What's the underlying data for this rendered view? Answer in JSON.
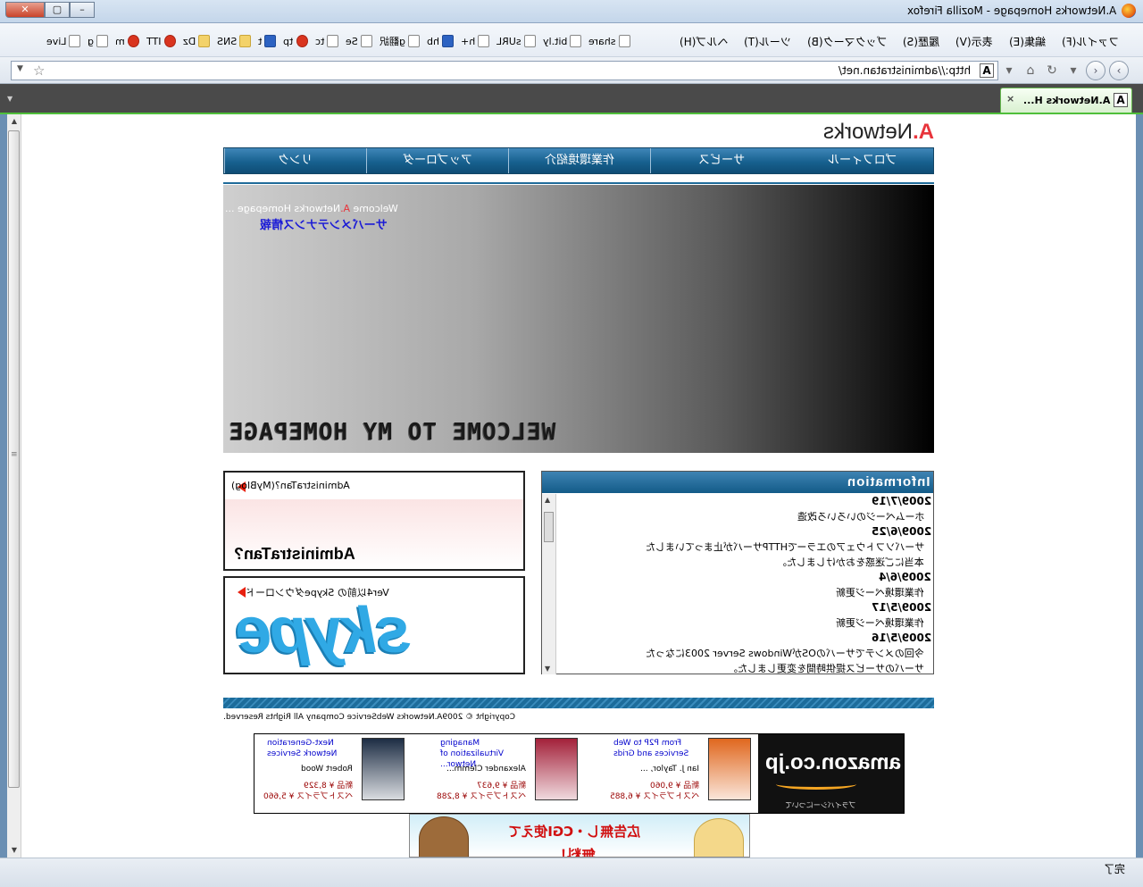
{
  "window": {
    "title": "A.Networks Homepage - Mozilla Firefox",
    "buttons": {
      "close": "✕",
      "maximize": "▢",
      "minimize": "–"
    }
  },
  "menubar": {
    "items": [
      "ファイル(F)",
      "編集(E)",
      "表示(V)",
      "履歴(S)",
      "ブックマーク(B)",
      "ツール(T)",
      "ヘルプ(H)"
    ]
  },
  "bookmarks": [
    {
      "label": "Live",
      "icon": "windows-live-icon"
    },
    {
      "label": "g",
      "icon": "google-icon"
    },
    {
      "label": "m",
      "icon": "gmail-icon"
    },
    {
      "label": "ITT",
      "icon": "itt-icon"
    },
    {
      "label": "Dz",
      "icon": "folder-icon"
    },
    {
      "label": "SNS",
      "icon": "folder-icon"
    },
    {
      "label": "t",
      "icon": "twitter-icon"
    },
    {
      "label": "tp",
      "icon": "tp-icon"
    },
    {
      "label": "tc",
      "icon": "tc-icon"
    },
    {
      "label": "Se",
      "icon": "se-icon"
    },
    {
      "label": "g翻訳",
      "icon": "page-icon"
    },
    {
      "label": "hb",
      "icon": "hatena-icon"
    },
    {
      "label": "h+",
      "icon": "page-icon"
    },
    {
      "label": "sURL",
      "icon": "page-icon"
    },
    {
      "label": "bit.ly",
      "icon": "page-icon"
    },
    {
      "label": "share",
      "icon": "page-icon"
    }
  ],
  "navbar": {
    "url": "http://administratan.net/",
    "site_icon": "A"
  },
  "tabs": [
    {
      "title": "A.Networks H...",
      "icon": "A",
      "close": "×"
    }
  ],
  "page": {
    "logo_prefix": "A.",
    "logo_text": "Networks",
    "nav": [
      "プロフィール",
      "サービス",
      "作業環境紹介",
      "アップローダ",
      "リンク"
    ],
    "hero": {
      "welcome_prefix": "Welcome ",
      "welcome_brand": "A.",
      "welcome_rest": "Networks Homepage ...",
      "link": "サーバメンテナンス情報",
      "banner": "WELCOME TO MY HOMEPAGE"
    },
    "blog": {
      "label": "AdministraTan?(MyBlog)",
      "title": "AdministraTan?"
    },
    "skype": {
      "label": "Ver4以前の Skypeダウンロード",
      "logo": "skype"
    },
    "info": {
      "heading": "Information",
      "entries": [
        {
          "date": "2009/7/19",
          "lines": [
            "ホームページのいろいろ改造"
          ]
        },
        {
          "date": "2009/6/25",
          "lines": [
            "サーバソフトウェアのエラーでHTTPサーバが止まっていました",
            "本当にご迷惑をおかけしました。"
          ]
        },
        {
          "date": "2009/6/4",
          "lines": [
            "作業環境ページ更新"
          ]
        },
        {
          "date": "2009/5/17",
          "lines": [
            "作業環境ページ更新"
          ]
        },
        {
          "date": "2009/5/16",
          "lines": [
            "今回のメンテでサーバのOSがWindows Server 2003になった",
            "サーバのサービス提供時間を変更しました。"
          ]
        }
      ]
    },
    "copyright": "Copyright © 2009A.Networks WebService Company All Rights Reserved.",
    "amazon": {
      "brand": "amazon.co.jp",
      "privacy": "プライバシーについて",
      "products": [
        {
          "title": "From P2P to Web Services and Grids",
          "author": "Ian J. Taylor, ...",
          "new": "新品 ¥ 9,060",
          "used": "ベストプライス ¥ 6,885"
        },
        {
          "title": "Managing Virtualization of Networ...",
          "author": "Alexander Clemm...",
          "new": "新品 ¥ 9,637",
          "used": "ベストプライス ¥ 8,288"
        },
        {
          "title": "Next-Generation Network Services",
          "author": "Robert Wood",
          "new": "新品 ¥ 8,329",
          "used": "ベストプライス ¥ 5,660"
        }
      ]
    },
    "ad": {
      "line1": "広告無し・CGI使えて",
      "line2": "無料！"
    }
  },
  "status": "完了"
}
